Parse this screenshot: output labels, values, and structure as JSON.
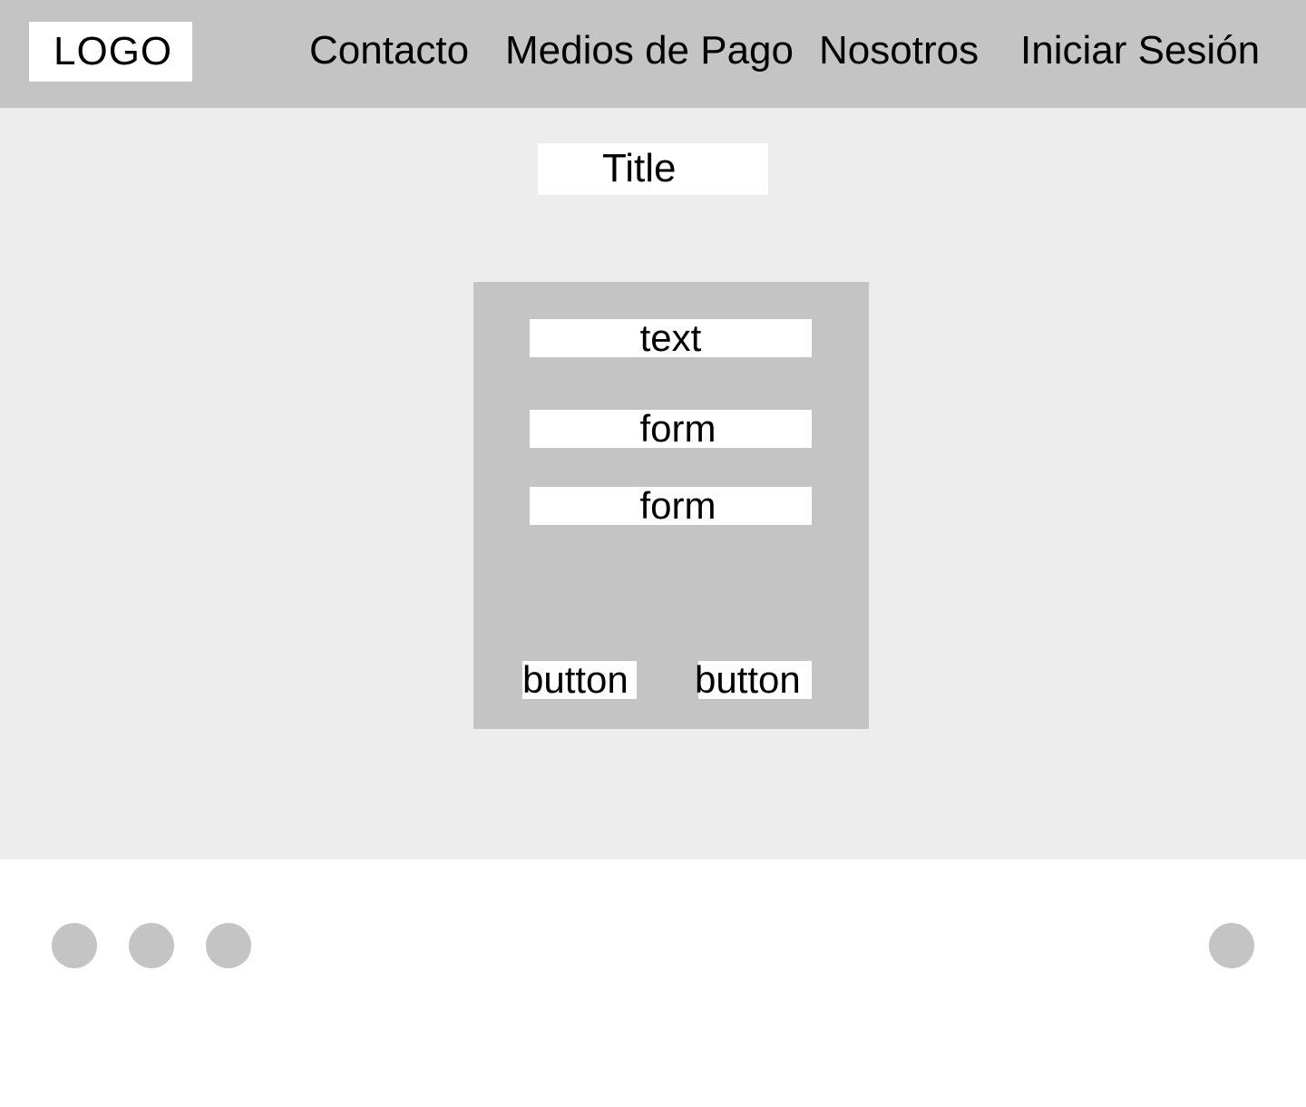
{
  "header": {
    "logo": "LOGO",
    "nav": {
      "contacto": "Contacto",
      "medios_pago": "Medios de Pago",
      "nosotros": "Nosotros",
      "iniciar_sesion": "Iniciar Sesión"
    }
  },
  "main": {
    "title": "Title",
    "card": {
      "text": "text",
      "form1": "form",
      "form2": "form",
      "button1": "button",
      "button2": "button"
    }
  },
  "footer": {
    "icons": [
      "circle-icon",
      "circle-icon",
      "circle-icon",
      "circle-icon"
    ]
  },
  "colors": {
    "header_bg": "#c4c4c4",
    "main_bg": "#ededed",
    "card_bg": "#c4c4c4",
    "footer_bg": "#ffffff"
  }
}
